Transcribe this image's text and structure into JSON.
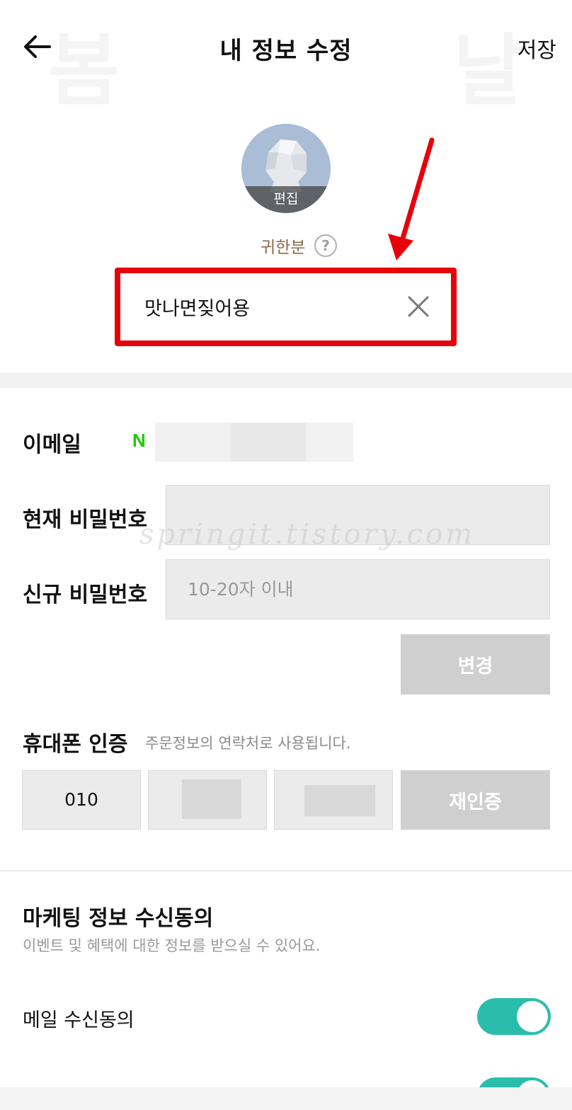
{
  "header": {
    "title": "내 정보 수정",
    "save_label": "저장",
    "back_icon": "arrow-left-icon"
  },
  "background_deco": [
    "봄",
    "날"
  ],
  "profile": {
    "avatar_edit_label": "편집",
    "nickname_label": "귀한분",
    "help_symbol": "?",
    "nickname_value": "맛나면짖어용",
    "clear_icon": "close-icon"
  },
  "annotation": {
    "highlight_color": "#e8000b",
    "arrow_icon": "red-arrow-icon"
  },
  "account": {
    "email_label": "이메일",
    "naver_badge": "N",
    "current_pw_label": "현재 비밀번호",
    "current_pw_value": "",
    "new_pw_label": "신규 비밀번호",
    "new_pw_placeholder": "10-20자 이내",
    "change_button": "변경"
  },
  "watermark": "springit.tistory.com",
  "phone": {
    "label": "휴대폰 인증",
    "hint": "주문정보의 연락처로 사용됩니다.",
    "prefix": "010",
    "reverify_button": "재인증"
  },
  "marketing": {
    "title": "마케팅 정보 수신동의",
    "description": "이벤트 및 혜택에 대한 정보를 받으실 수 있어요.",
    "mail_label": "메일 수신동의",
    "mail_enabled": true,
    "second_enabled": true,
    "toggle_color": "#2bbdac"
  }
}
